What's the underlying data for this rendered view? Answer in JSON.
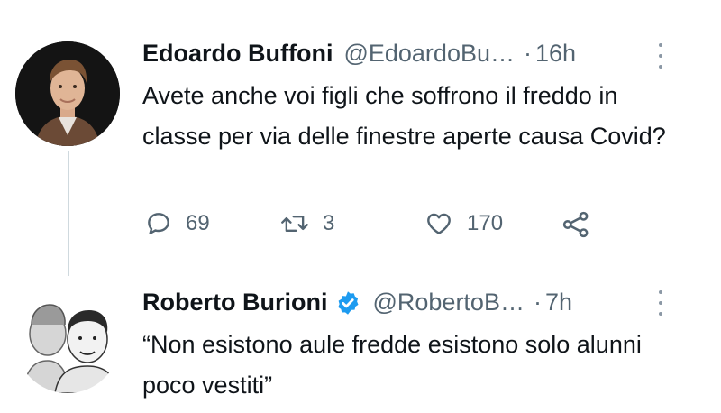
{
  "tweet1": {
    "name": "Edoardo Buffoni",
    "handle": "@EdoardoBu…",
    "separator": "·",
    "time": "16h",
    "text": "Avete anche voi figli che soffrono il freddo in classe per via delle finestre aperte causa Covid?",
    "avatar": "profile-photo-man",
    "stats": {
      "replies": "69",
      "retweets": "3",
      "likes": "170"
    }
  },
  "tweet2": {
    "name": "Roberto Burioni",
    "handle": "@RobertoB…",
    "separator": "·",
    "time": "7h",
    "verified": true,
    "text": "“Non esistono aule fredde esistono solo alunni poco vestiti”",
    "avatar": "profile-photo-two-men-caricature"
  },
  "icons": {
    "reply": "reply-icon",
    "retweet": "retweet-icon",
    "like": "heart-icon",
    "share": "share-icon",
    "more": "more-icon",
    "verified": "verified-badge-icon"
  },
  "colors": {
    "text": "#0f1419",
    "secondary": "#536471",
    "verified": "#1d9bf0",
    "thread_line": "#cfd9de"
  }
}
